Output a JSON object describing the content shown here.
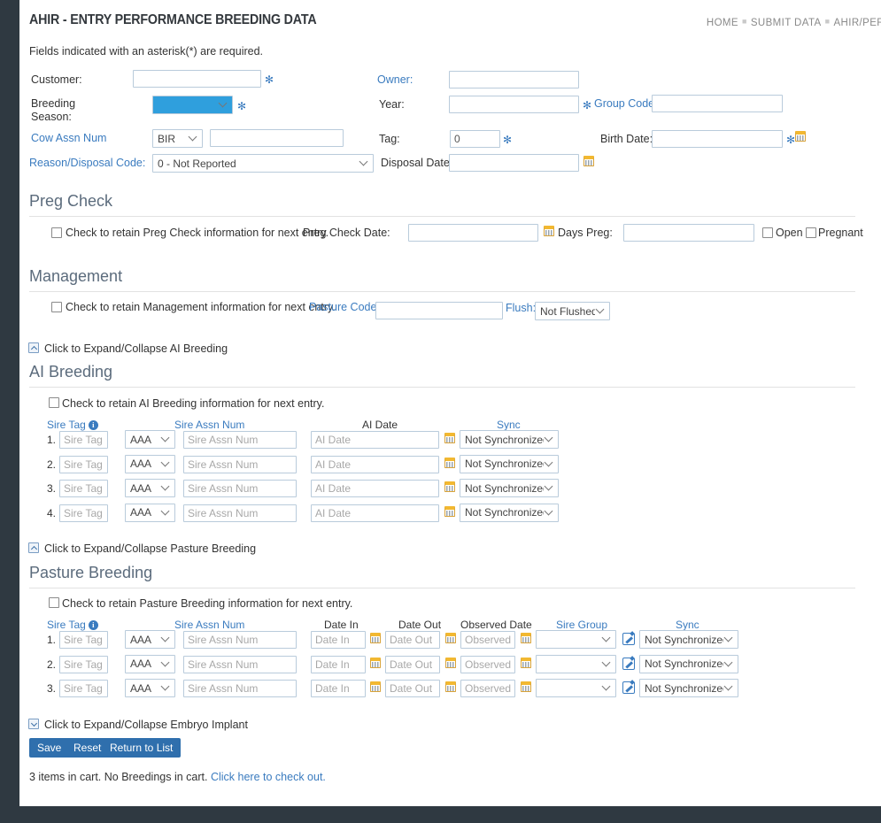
{
  "theme": {
    "chrome_dark": "#2f3941",
    "accent_blue": "#3a7bbf",
    "button_blue": "#2f6fad",
    "heading_gray": "#5b6b7c",
    "input_border": "#b9cbdb",
    "calendar_yellow": "#f2b831"
  },
  "header": {
    "title": "AHIR - ENTRY PERFORMANCE BREEDING DATA",
    "required_note": "Fields indicated with an asterisk(*) are required.",
    "breadcrumb": [
      {
        "label": "HOME"
      },
      {
        "label": "SUBMIT DATA"
      },
      {
        "label": "AHIR/PER"
      }
    ]
  },
  "top_form": {
    "customer": {
      "label": "Customer:",
      "value": "",
      "required": true
    },
    "owner": {
      "label": "Owner:",
      "value": "",
      "required": false
    },
    "breeding_season": {
      "label": "Breeding Season:",
      "selected": "",
      "required": true,
      "highlighted": true
    },
    "year": {
      "label": "Year:",
      "value": "",
      "required": true
    },
    "group_code": {
      "label": "Group Code:",
      "value": "",
      "required": false
    },
    "cow_assn_num": {
      "label": "Cow Assn Num",
      "prefix_selected": "BIR",
      "value": ""
    },
    "tag": {
      "label": "Tag:",
      "value": "0",
      "required": true
    },
    "birth_date": {
      "label": "Birth Date:",
      "value": "",
      "required": true,
      "has_calendar": true
    },
    "reason_disposal_code": {
      "label": "Reason/Disposal Code:",
      "selected": "0 - Not Reported"
    },
    "disposal_date": {
      "label": "Disposal Date:",
      "value": "",
      "has_calendar": true
    }
  },
  "preg_check": {
    "heading": "Preg Check",
    "retain_label": "Check to retain Preg Check information for next entry.",
    "retain_checked": false,
    "date_label": "Preg Check Date:",
    "date_value": "",
    "days_preg_label": "Days Preg:",
    "days_preg_value": "",
    "open_label": "Open",
    "open_checked": false,
    "pregnant_label": "Pregnant",
    "pregnant_checked": false
  },
  "management": {
    "heading": "Management",
    "retain_label": "Check to retain Management information for next entry.",
    "retain_checked": false,
    "pasture_code_label": "Pasture Code:",
    "pasture_code_value": "",
    "flush_label": "Flush:",
    "flush_selected": "Not Flushed"
  },
  "ai_breeding": {
    "toggle_label": "Click to Expand/Collapse AI Breeding",
    "toggle_state": "expanded",
    "heading": "AI Breeding",
    "retain_label": "Check to retain AI Breeding information for next entry.",
    "retain_checked": false,
    "columns": [
      "Sire Tag",
      "Sire Assn Num",
      "AI Date",
      "Sync"
    ],
    "rows": [
      {
        "num": "1.",
        "sire_tag": "",
        "sire_tag_ph": "Sire Tag",
        "assn_prefix": "AAA",
        "assn_num": "",
        "assn_num_ph": "Sire Assn Num",
        "ai_date": "",
        "ai_date_ph": "AI Date",
        "sync": "Not Synchronized"
      },
      {
        "num": "2.",
        "sire_tag": "",
        "sire_tag_ph": "Sire Tag",
        "assn_prefix": "AAA",
        "assn_num": "",
        "assn_num_ph": "Sire Assn Num",
        "ai_date": "",
        "ai_date_ph": "AI Date",
        "sync": "Not Synchronized"
      },
      {
        "num": "3.",
        "sire_tag": "",
        "sire_tag_ph": "Sire Tag",
        "assn_prefix": "AAA",
        "assn_num": "",
        "assn_num_ph": "Sire Assn Num",
        "ai_date": "",
        "ai_date_ph": "AI Date",
        "sync": "Not Synchronized"
      },
      {
        "num": "4.",
        "sire_tag": "",
        "sire_tag_ph": "Sire Tag",
        "assn_prefix": "AAA",
        "assn_num": "",
        "assn_num_ph": "Sire Assn Num",
        "ai_date": "",
        "ai_date_ph": "AI Date",
        "sync": "Not Synchronized"
      }
    ]
  },
  "pasture_breeding": {
    "toggle_label": "Click to Expand/Collapse Pasture Breeding",
    "toggle_state": "expanded",
    "heading": "Pasture Breeding",
    "retain_label": "Check to retain Pasture Breeding information for next entry.",
    "retain_checked": false,
    "columns": [
      "Sire Tag",
      "Sire Assn Num",
      "Date In",
      "Date Out",
      "Observed Date",
      "Sire Group",
      "Sync"
    ],
    "rows": [
      {
        "num": "1.",
        "sire_tag": "",
        "sire_tag_ph": "Sire Tag",
        "assn_prefix": "AAA",
        "assn_num": "",
        "assn_num_ph": "Sire Assn Num",
        "date_in": "",
        "date_in_ph": "Date In",
        "date_out": "",
        "date_out_ph": "Date Out",
        "observed": "",
        "observed_ph": "Observed Date",
        "sire_group": "",
        "sync": "Not Synchronized"
      },
      {
        "num": "2.",
        "sire_tag": "",
        "sire_tag_ph": "Sire Tag",
        "assn_prefix": "AAA",
        "assn_num": "",
        "assn_num_ph": "Sire Assn Num",
        "date_in": "",
        "date_in_ph": "Date In",
        "date_out": "",
        "date_out_ph": "Date Out",
        "observed": "",
        "observed_ph": "Observed Date",
        "sire_group": "",
        "sync": "Not Synchronized"
      },
      {
        "num": "3.",
        "sire_tag": "",
        "sire_tag_ph": "Sire Tag",
        "assn_prefix": "AAA",
        "assn_num": "",
        "assn_num_ph": "Sire Assn Num",
        "date_in": "",
        "date_in_ph": "Date In",
        "date_out": "",
        "date_out_ph": "Date Out",
        "observed": "",
        "observed_ph": "Observed Date",
        "sire_group": "",
        "sync": "Not Synchronized"
      }
    ]
  },
  "embryo_implant": {
    "toggle_label": "Click to Expand/Collapse Embryo Implant",
    "toggle_state": "collapsed"
  },
  "actions": {
    "save": "Save",
    "reset": "Reset",
    "return_to_list": "Return to List"
  },
  "cart": {
    "text": "3 items in cart. No Breedings in cart.",
    "link": "Click here to check out."
  }
}
